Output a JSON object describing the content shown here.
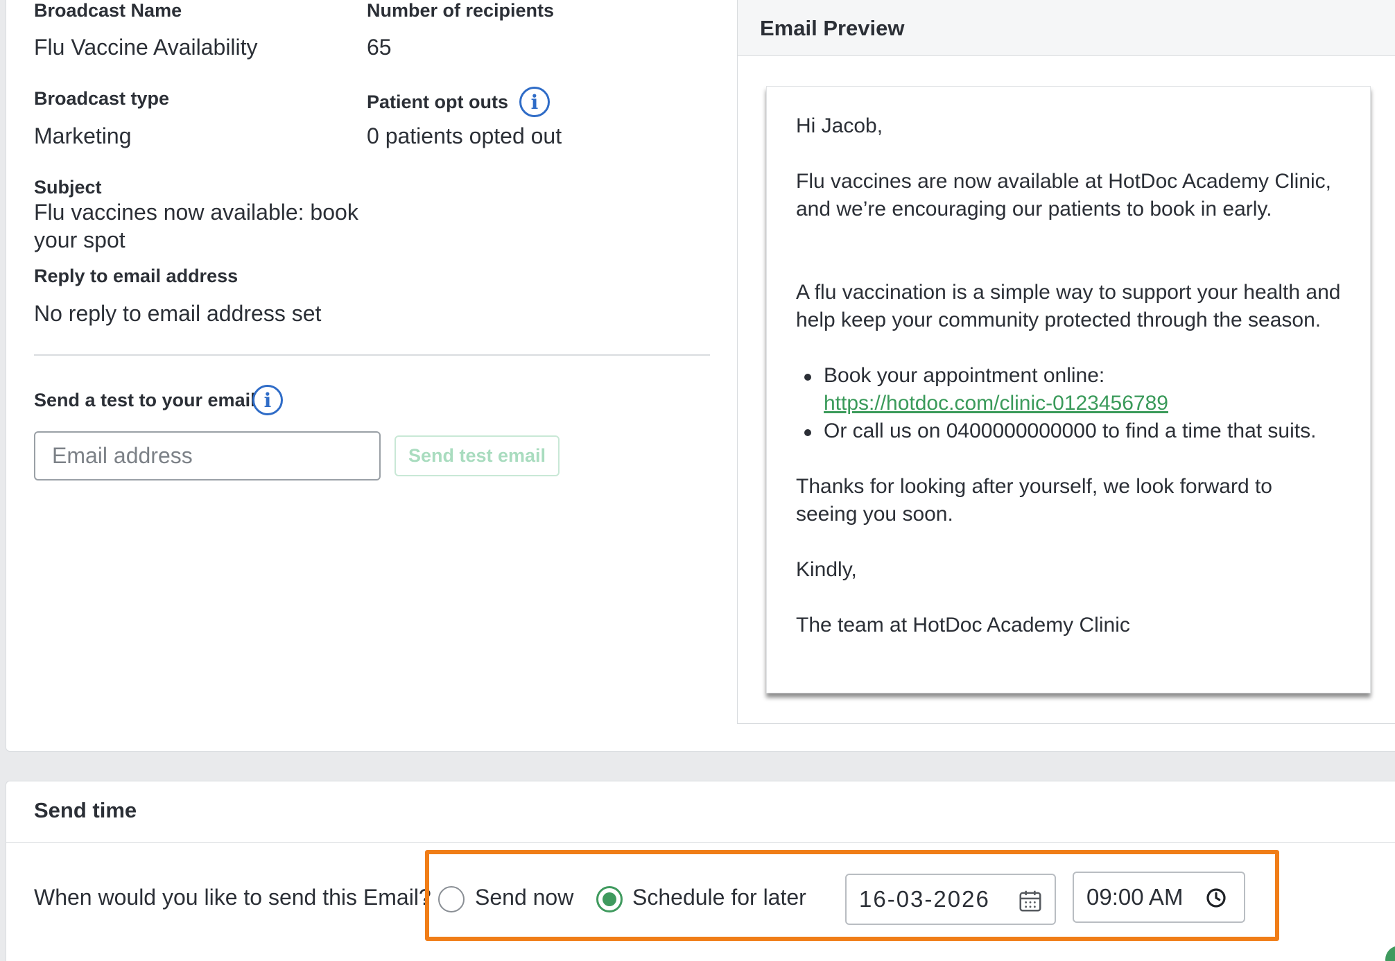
{
  "details": {
    "broadcast_name_label": "Broadcast Name",
    "broadcast_name_value": "Flu Vaccine Availability",
    "recipients_label": "Number of recipients",
    "recipients_value": "65",
    "broadcast_type_label": "Broadcast type",
    "broadcast_type_value": "Marketing",
    "opt_outs_label": "Patient opt outs",
    "opt_outs_value": "0 patients opted out",
    "subject_label": "Subject",
    "subject_value_line1": "Flu vaccines now available: book",
    "subject_value_line2": "your spot",
    "reply_label": "Reply to email address",
    "reply_value": "No reply to email address set"
  },
  "test_email": {
    "label": "Send a test to your email",
    "placeholder": "Email address",
    "button_label": "Send test email"
  },
  "preview": {
    "title": "Email Preview",
    "greeting": "Hi Jacob,",
    "para1": "Flu vaccines are now available at HotDoc Academy Clinic, and we’re encouraging our patients to book in early.",
    "para2": "A flu vaccination is a simple way to support your health and help keep your community protected through the season.",
    "bullet1_text": "Book your appointment online:",
    "bullet1_link": "https://hotdoc.com/clinic-0123456789",
    "bullet2_text": "Or call us on 0400000000000 to find a time that suits.",
    "para3": "Thanks for looking after yourself, we look forward to seeing you soon.",
    "signoff": "Kindly,",
    "signature": "The team at HotDoc Academy Clinic"
  },
  "send_time": {
    "title": "Send time",
    "question": "When would you like to send this Email?",
    "option_now": "Send now",
    "option_later": "Schedule for later",
    "selected": "Schedule for later",
    "date": "16-03-2026",
    "time": "09:00 AM"
  },
  "icons": [
    "info-icon",
    "calendar-icon",
    "clock-icon"
  ],
  "colors": {
    "accent_green": "#3f9a5e",
    "info_blue": "#2f6cc7",
    "highlight_orange": "#f07d17",
    "link_green": "#3a9a5a"
  }
}
